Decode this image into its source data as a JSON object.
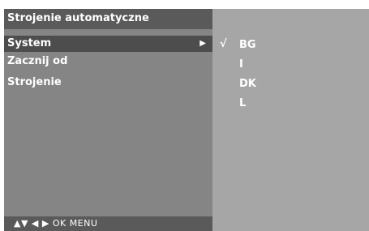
{
  "title": "Strojenie automatyczne",
  "menu": {
    "items": [
      {
        "label": "System",
        "selected": true,
        "has_submenu": true
      },
      {
        "label": "Zacznij od",
        "selected": false,
        "has_submenu": false
      },
      {
        "label": "Strojenie",
        "selected": false,
        "has_submenu": false
      }
    ],
    "submenu_arrow": "▶"
  },
  "footer": {
    "hint": "▲▼  ◀ ▶  OK  MENU"
  },
  "options": {
    "check_mark": "√",
    "items": [
      {
        "label": "BG",
        "checked": true
      },
      {
        "label": "I",
        "checked": false
      },
      {
        "label": "DK",
        "checked": false
      },
      {
        "label": "L",
        "checked": false
      }
    ]
  },
  "colors": {
    "page_background": "#ffffff",
    "title_bar": "#5a5a5a",
    "menu_panel": "#858585",
    "selected_item": "#4d4d4d",
    "options_panel": "#a6a6a6",
    "text": "#ffffff"
  },
  "icons": {
    "submenu_arrow": "submenu-arrow-icon",
    "check": "check-icon",
    "nav_hint": "navigation-keys-icon"
  }
}
